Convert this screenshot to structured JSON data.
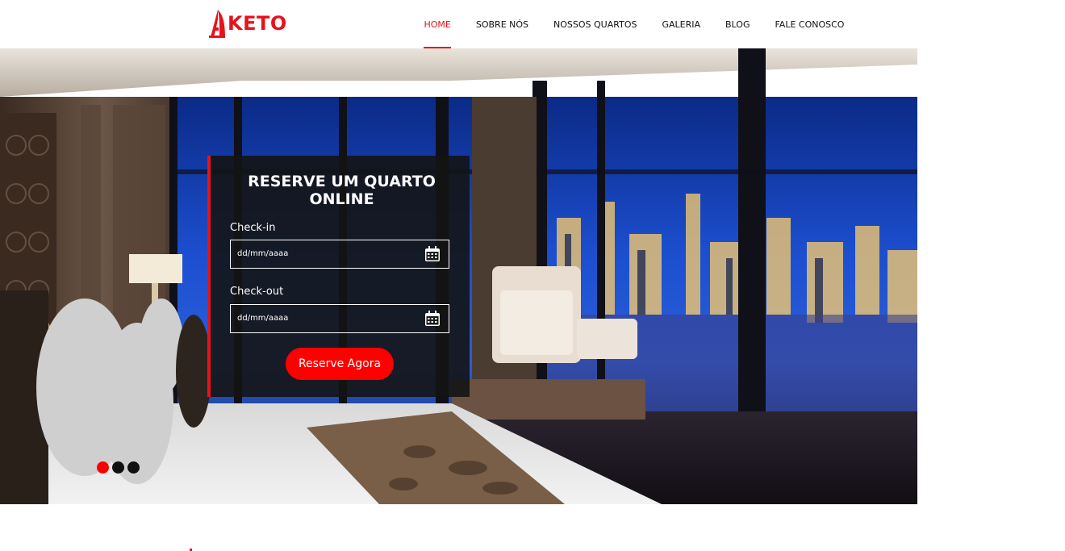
{
  "brand": {
    "name": "KETO",
    "accent": "#e8121b"
  },
  "nav": {
    "items": [
      {
        "label": "HOME",
        "active": true
      },
      {
        "label": "SOBRE NÓS",
        "active": false
      },
      {
        "label": "NOSSOS QUARTOS",
        "active": false
      },
      {
        "label": "GALERIA",
        "active": false
      },
      {
        "label": "BLOG",
        "active": false
      },
      {
        "label": "FALE CONOSCO",
        "active": false
      }
    ]
  },
  "booking": {
    "title": "RESERVE UM QUARTO ONLINE",
    "checkin": {
      "label": "Check-in",
      "placeholder": "dd/mm/aaaa",
      "icon": "calendar-icon"
    },
    "checkout": {
      "label": "Check-out",
      "placeholder": "dd/mm/aaaa",
      "icon": "calendar-icon"
    },
    "button": "Reserve Agora",
    "button_color": "#ff0000"
  },
  "slider": {
    "slides": 3,
    "active": 1
  }
}
